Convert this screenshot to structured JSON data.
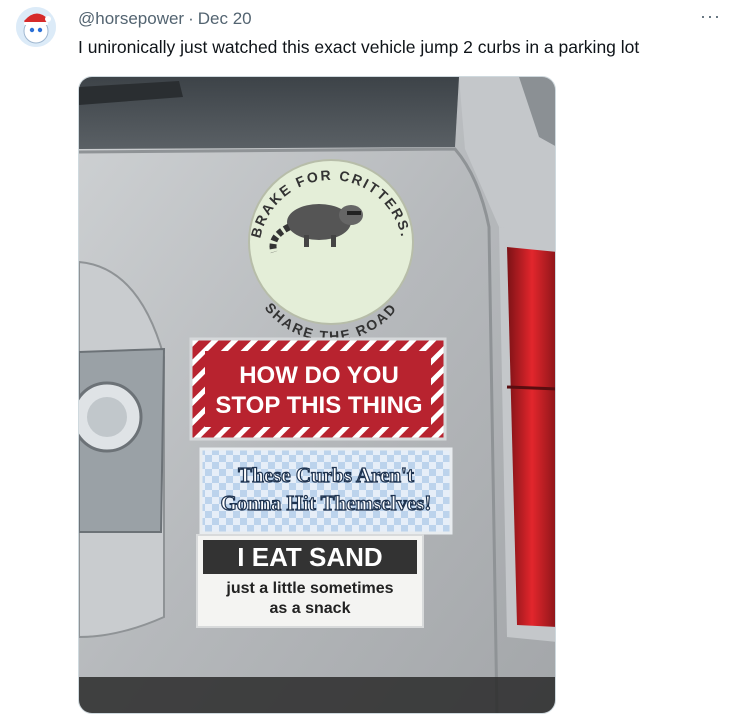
{
  "tweet": {
    "handle": "@horsepower",
    "separator": "·",
    "date": "Dec 20",
    "more_label": "···",
    "text": "I unironically just watched this exact vehicle jump 2 curbs in a parking lot"
  },
  "stickers": {
    "circle_top": "BRAKE FOR CRITTERS.",
    "circle_bottom": "SHARE THE ROAD",
    "red_line1": "HOW DO YOU",
    "red_line2": "STOP THIS THING",
    "checker_line1": "These Curbs Aren't",
    "checker_line2": "Gonna Hit Themselves!",
    "sand_line1": "I EAT SAND",
    "sand_line2": "just a little sometimes",
    "sand_line3": "as a snack"
  },
  "colors": {
    "text_primary": "#0f1419",
    "text_secondary": "#536471",
    "car_silver": "#b9bcbf",
    "sticker_red": "#b8232f",
    "sticker_checker": "#c9dbef",
    "taillight_red": "#d11f25"
  }
}
